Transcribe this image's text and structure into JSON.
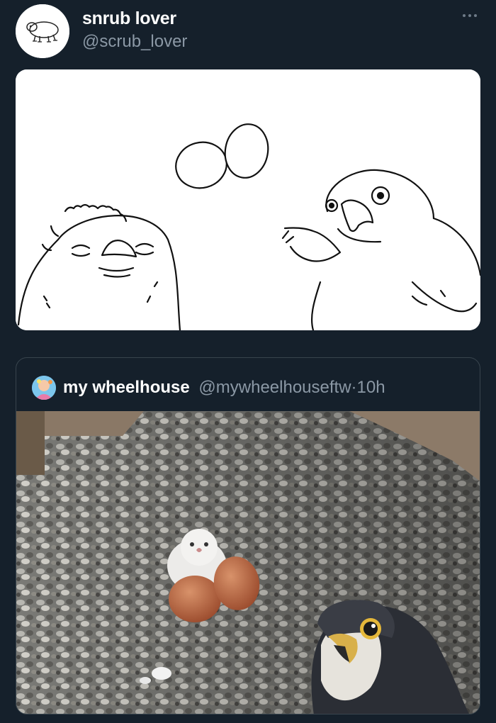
{
  "tweet": {
    "display_name": "snrub lover",
    "handle": "@scrub_lover",
    "avatar_icon": "sloth-doodle-avatar",
    "more_icon": "more-dots-icon"
  },
  "media": {
    "image_1": "drawing of falcon chick and adult falcon with eggs",
    "image_2": "photo of falcon chick with eggs on gravel and adult falcon"
  },
  "quoted": {
    "display_name": "my wheelhouse",
    "handle": "@mywheelhouseftw",
    "separator": "·",
    "time": "10h",
    "avatar_icon": "colorful-avatar"
  },
  "colors": {
    "background": "#15202b",
    "secondary_text": "#8b98a5",
    "border": "#38444d"
  }
}
